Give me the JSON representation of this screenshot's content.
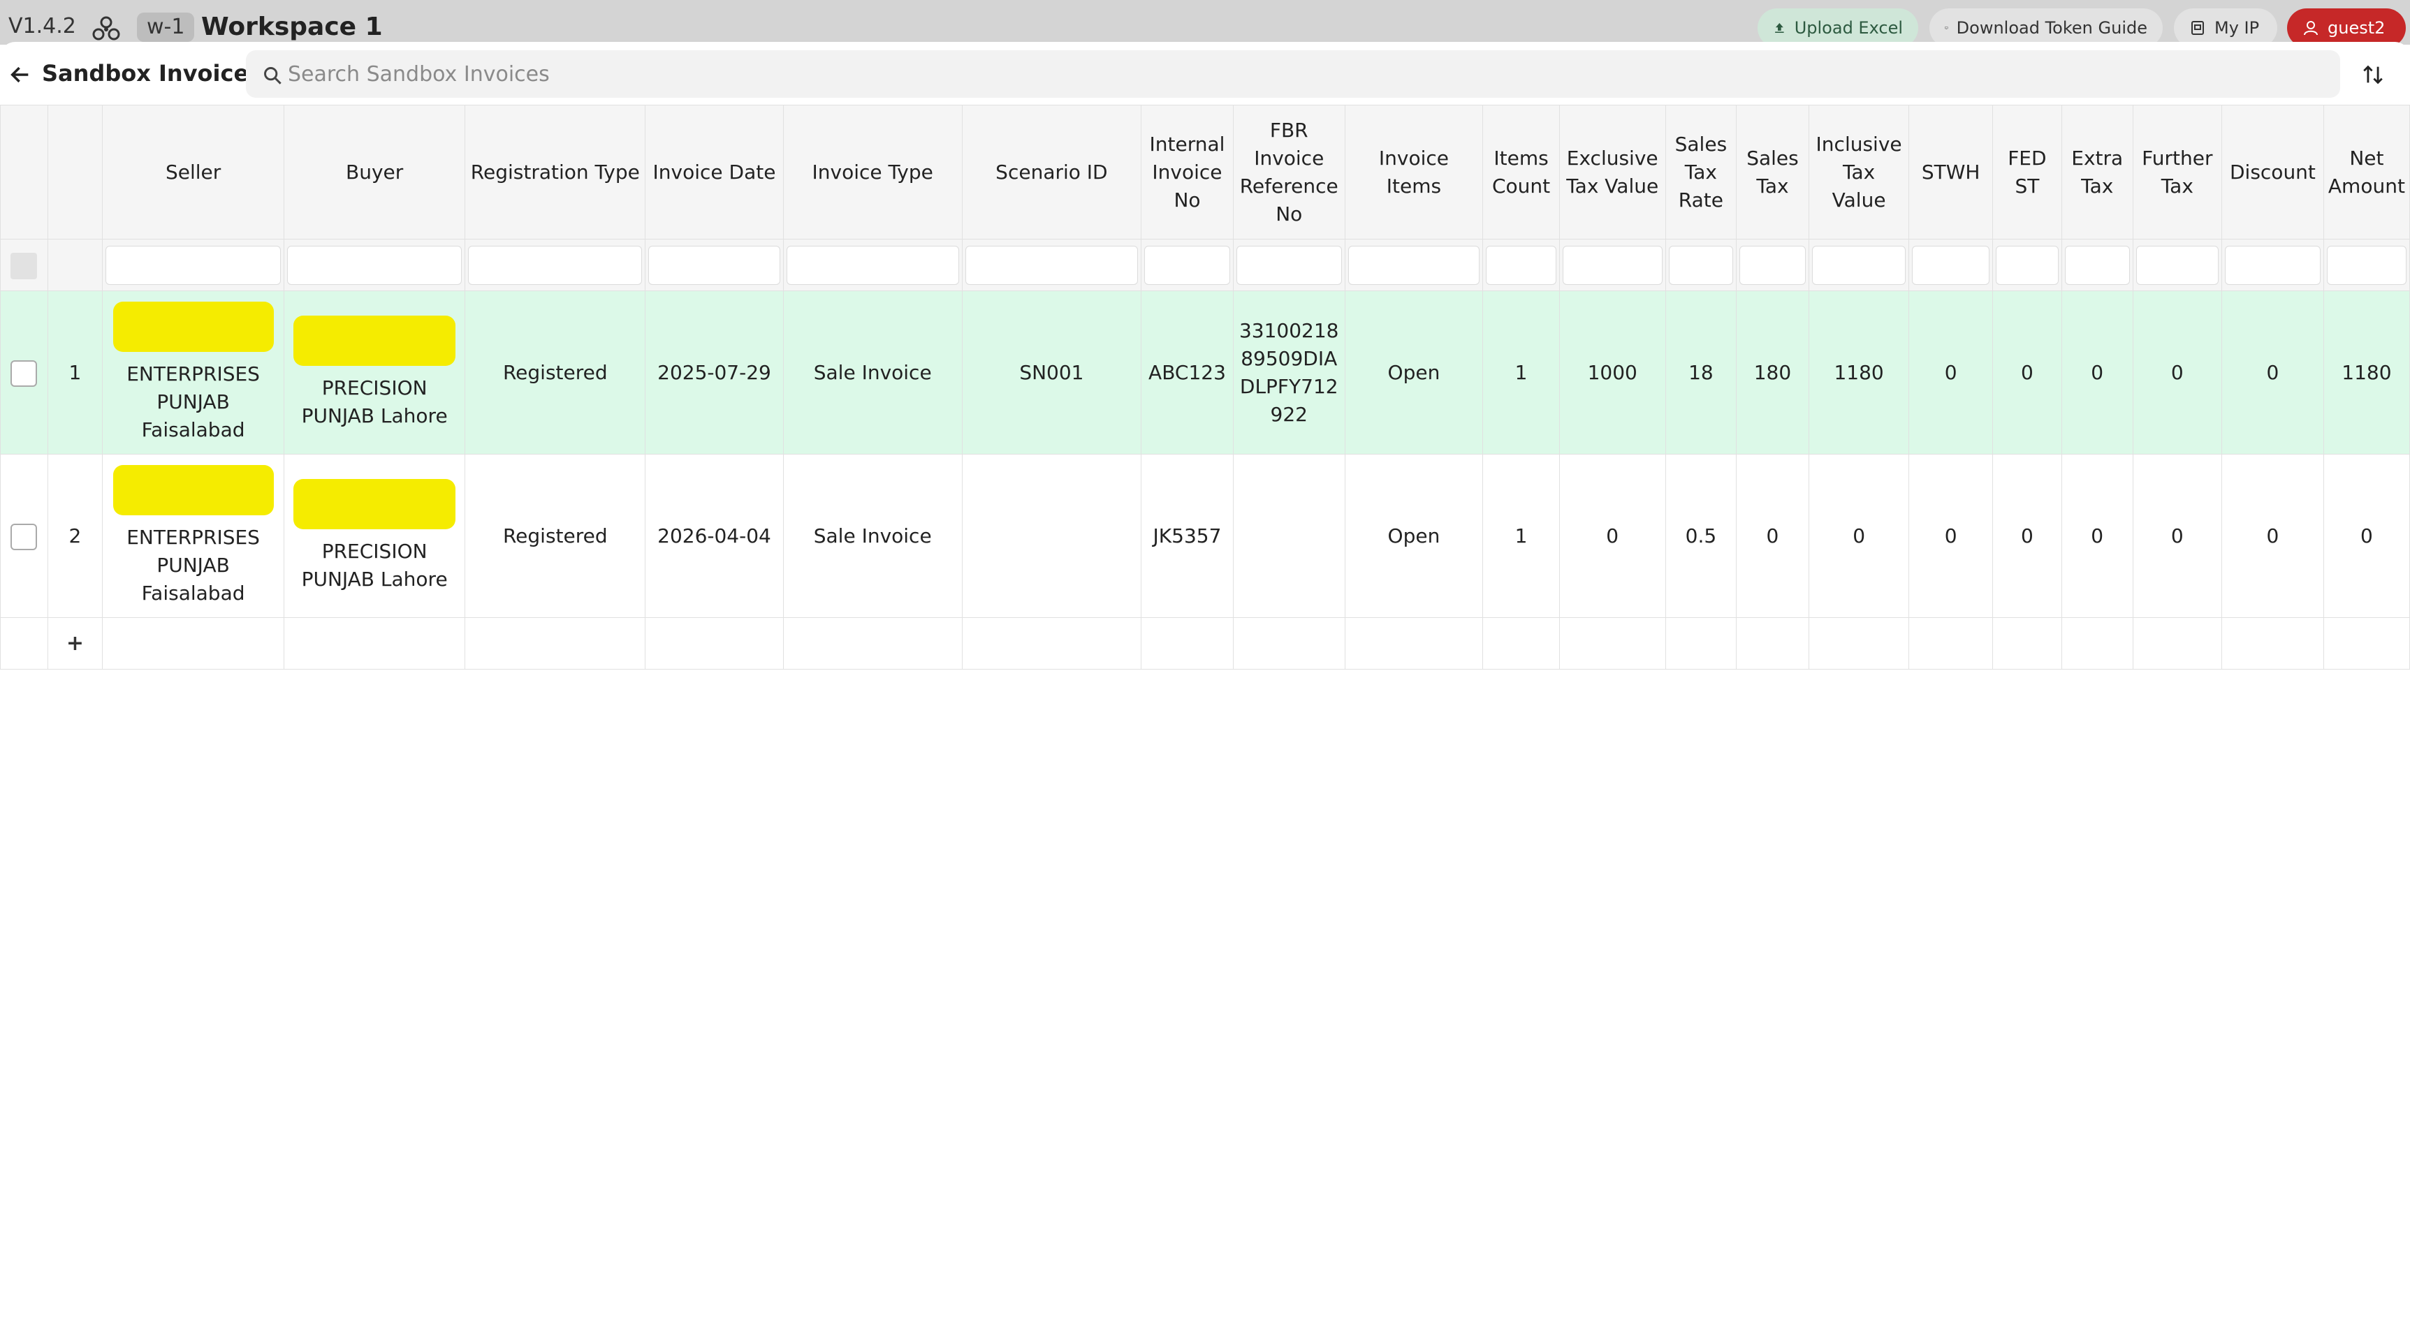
{
  "topbar": {
    "version": "V1.4.2",
    "workspace_tag": "w-1",
    "workspace_title": "Workspace 1",
    "buttons": {
      "upload": "Upload Excel",
      "guide": "Download Token Guide",
      "ip": "My IP",
      "user": "guest2"
    },
    "colors": {
      "upload_bg": "#cfe6d8",
      "user_bg": "#c62828"
    }
  },
  "sheet": {
    "title": "Sandbox Invoices",
    "search_placeholder": "Search Sandbox Invoices"
  },
  "columns": [
    "",
    "",
    "Seller",
    "Buyer",
    "Registration Type",
    "Invoice Date",
    "Invoice Type",
    "Scenario ID",
    "Internal Invoice No",
    "FBR Invoice Reference No",
    "Invoice Items",
    "Items Count",
    "Exclusive Tax Value",
    "Sales Tax Rate",
    "Sales Tax",
    "Inclusive Tax Value",
    "STWH",
    "FED ST",
    "Extra Tax",
    "Further Tax",
    "Discount",
    "Net Amount"
  ],
  "rows": [
    {
      "row_no": "1",
      "seller": [
        "ENTERPRISES",
        "PUNJAB",
        "Faisalabad"
      ],
      "buyer": [
        "PRECISION",
        "PUNJAB Lahore"
      ],
      "registration_type": "Registered",
      "invoice_date": "2025-07-29",
      "invoice_type": "Sale Invoice",
      "scenario_id": "SN001",
      "internal_invoice_no": "ABC123",
      "fbr_reference_no": "3310021889509DIADLPFY712922",
      "invoice_items": "Open",
      "items_count": "1",
      "exclusive_tax_value": "1000",
      "sales_tax_rate": "18",
      "sales_tax": "180",
      "inclusive_tax_value": "1180",
      "stwh": "0",
      "fed_st": "0",
      "extra_tax": "0",
      "further_tax": "0",
      "discount": "0",
      "net_amount": "1180",
      "highlight": "#dcf9e8"
    },
    {
      "row_no": "2",
      "seller": [
        "ENTERPRISES",
        "PUNJAB",
        "Faisalabad"
      ],
      "buyer": [
        "PRECISION",
        "PUNJAB Lahore"
      ],
      "registration_type": "Registered",
      "invoice_date": "2026-04-04",
      "invoice_type": "Sale Invoice",
      "scenario_id": "",
      "internal_invoice_no": "JK5357",
      "fbr_reference_no": "",
      "invoice_items": "Open",
      "items_count": "1",
      "exclusive_tax_value": "0",
      "sales_tax_rate": "0.5",
      "sales_tax": "0",
      "inclusive_tax_value": "0",
      "stwh": "0",
      "fed_st": "0",
      "extra_tax": "0",
      "further_tax": "0",
      "discount": "0",
      "net_amount": "0"
    }
  ],
  "add_row_label": "+",
  "redaction_color": "#f5ec00"
}
